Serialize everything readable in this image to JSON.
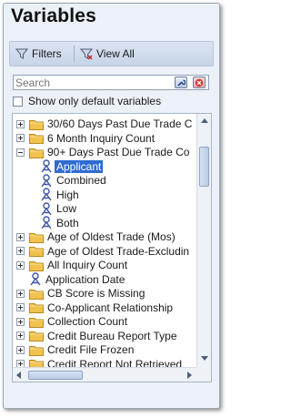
{
  "panel": {
    "title": "Variables"
  },
  "toolbar": {
    "filters_label": "Filters",
    "view_all_label": "View All"
  },
  "search": {
    "placeholder": "Search"
  },
  "default_filter": {
    "label": "Show only default variables",
    "checked": false
  },
  "tree": {
    "rows": [
      {
        "label": "30/60 Days Past Due Trade C",
        "type": "folder",
        "expander": "plus",
        "level": 0,
        "selected": false
      },
      {
        "label": "6 Month Inquiry Count",
        "type": "folder",
        "expander": "plus",
        "level": 0,
        "selected": false
      },
      {
        "label": "90+ Days Past Due Trade Co",
        "type": "folder",
        "expander": "minus",
        "level": 0,
        "selected": false
      },
      {
        "label": "Applicant",
        "type": "variable",
        "expander": "none",
        "level": 1,
        "selected": true
      },
      {
        "label": "Combined",
        "type": "variable",
        "expander": "none",
        "level": 1,
        "selected": false
      },
      {
        "label": "High",
        "type": "variable",
        "expander": "none",
        "level": 1,
        "selected": false
      },
      {
        "label": "Low",
        "type": "variable",
        "expander": "none",
        "level": 1,
        "selected": false
      },
      {
        "label": "Both",
        "type": "variable",
        "expander": "none",
        "level": 1,
        "selected": false
      },
      {
        "label": "Age of Oldest Trade (Mos)",
        "type": "folder",
        "expander": "plus",
        "level": 0,
        "selected": false
      },
      {
        "label": "Age of Oldest Trade-Excludin",
        "type": "folder",
        "expander": "plus",
        "level": 0,
        "selected": false
      },
      {
        "label": "All Inquiry Count",
        "type": "folder",
        "expander": "plus",
        "level": 0,
        "selected": false
      },
      {
        "label": "Application Date",
        "type": "variable",
        "expander": "none",
        "level": 0,
        "selected": false
      },
      {
        "label": "CB Score is Missing",
        "type": "folder",
        "expander": "plus",
        "level": 0,
        "selected": false
      },
      {
        "label": "Co-Applicant Relationship",
        "type": "folder",
        "expander": "plus",
        "level": 0,
        "selected": false
      },
      {
        "label": "Collection Count",
        "type": "folder",
        "expander": "plus",
        "level": 0,
        "selected": false
      },
      {
        "label": "Credit Bureau Report Type",
        "type": "folder",
        "expander": "plus",
        "level": 0,
        "selected": false
      },
      {
        "label": "Credit File Frozen",
        "type": "folder",
        "expander": "plus",
        "level": 0,
        "selected": false
      },
      {
        "label": "Credit Report Not Retrieved",
        "type": "folder",
        "expander": "plus",
        "level": 0,
        "selected": false
      }
    ]
  },
  "colors": {
    "accent": "#2f6bd1",
    "folder": "#f2c24f",
    "panel_bg": "#ecf1f8"
  }
}
